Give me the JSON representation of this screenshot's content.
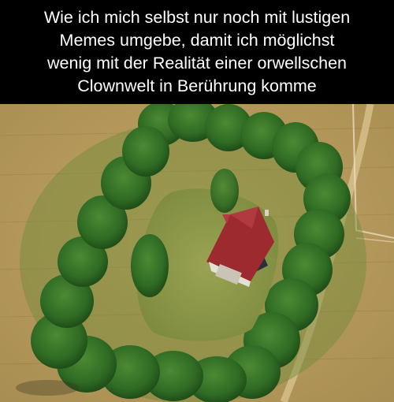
{
  "caption": {
    "text": "Wie ich mich selbst nur noch mit lustigen\nMemes umgebe, damit ich möglichst\nwenig mit der Realität einer orwellschen\nClownwelt in Berührung komme"
  },
  "colors": {
    "caption_background": "#000000",
    "caption_text": "#ffffff",
    "field": "#b59a5e",
    "trees": "#2f6b24",
    "lawn": "#8e9a4c",
    "roof": "#9c2a2e"
  },
  "photo": {
    "icons": [
      "tree-hedge-ring",
      "cabin-red-roof",
      "dirt-path",
      "fence"
    ]
  }
}
